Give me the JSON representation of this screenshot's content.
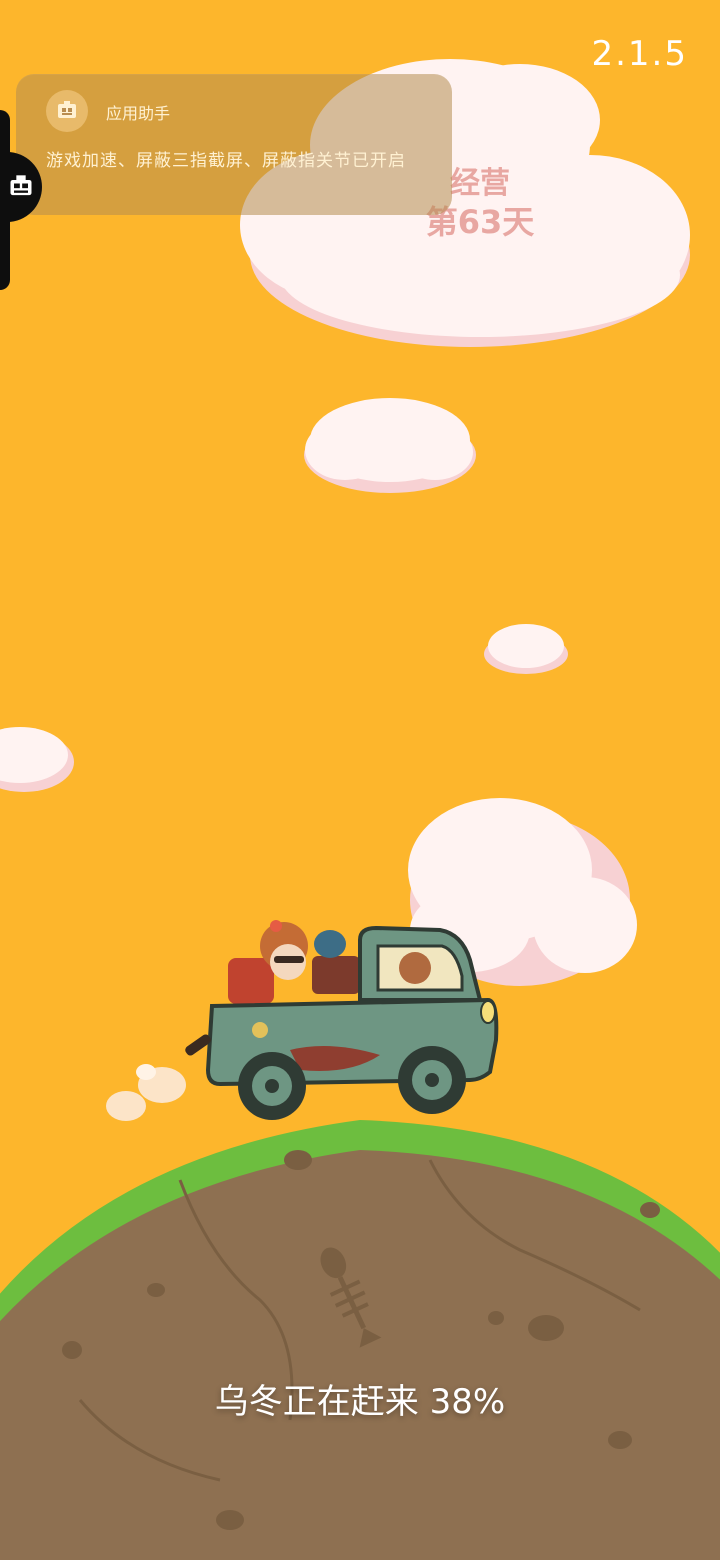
{
  "version": "2.1.5",
  "assistant_toast": {
    "app_name": "应用助手",
    "message": "游戏加速、屏蔽三指截屏、屏蔽指关节已开启",
    "icon": "app-assistant-icon"
  },
  "side_handle": {
    "icon": "app-assistant-icon"
  },
  "day_counter": {
    "label": "经营",
    "day": "第63天"
  },
  "loading": {
    "text": "乌冬正在赶来 38%",
    "progress_percent": 38
  },
  "colors": {
    "sky": "#FDB62C",
    "grass": "#6DBE3F",
    "dirt": "#8E7051",
    "cloud": "#FFF3F2",
    "cloud_shadow": "#F7D1D3",
    "day_text": "#E8A7A2"
  }
}
